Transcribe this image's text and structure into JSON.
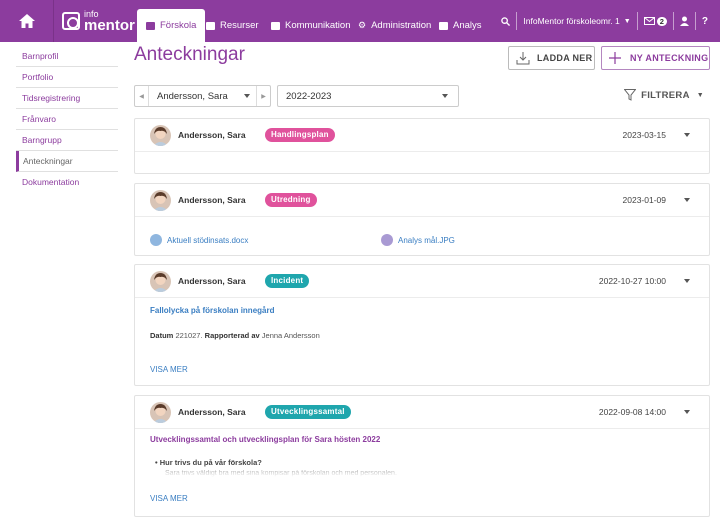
{
  "nav": {
    "logo_top": "info",
    "logo_bottom": "mentor",
    "tabs": [
      {
        "label": "Förskola"
      },
      {
        "label": "Resurser"
      },
      {
        "label": "Kommunikation"
      },
      {
        "label": "Administration"
      },
      {
        "label": "Analys"
      }
    ],
    "account_label": "InfoMentor förskoleomr. 1",
    "message_count": "2",
    "help_label": "?"
  },
  "sidebar": {
    "items": [
      {
        "label": "Barnprofil"
      },
      {
        "label": "Portfolio"
      },
      {
        "label": "Tidsregistrering"
      },
      {
        "label": "Frånvaro"
      },
      {
        "label": "Barngrupp"
      },
      {
        "label": "Anteckningar"
      },
      {
        "label": "Dokumentation"
      }
    ]
  },
  "page": {
    "title": "Anteckningar",
    "download_label": "LADDA NER",
    "new_note_label": "NY ANTECKNING",
    "person_select": "Andersson, Sara",
    "year_select": "2022-2023",
    "filter_label": "FILTRERA"
  },
  "notes": [
    {
      "name": "Andersson, Sara",
      "tag": "Handlingsplan",
      "tag_color": "#e0529c",
      "date": "2023-03-15"
    },
    {
      "name": "Andersson, Sara",
      "tag": "Utredning",
      "tag_color": "#e0529c",
      "date": "2023-01-09",
      "attachments": [
        "Aktuell stödinsats.docx",
        "Analys mål.JPG"
      ]
    },
    {
      "name": "Andersson, Sara",
      "tag": "Incident",
      "tag_color": "#1fa6ad",
      "date": "2022-10-27 10:00",
      "title": "Fallolycka på förskolan innegård",
      "meta_datum_label": "Datum",
      "meta_datum": "221027.",
      "meta_rapp_label": "Rapporterad av",
      "meta_rapp": "Jenna Andersson",
      "more": "VISA MER"
    },
    {
      "name": "Andersson, Sara",
      "tag": "Utvecklingssamtal",
      "tag_color": "#1fa6ad",
      "date": "2022-09-08 14:00",
      "title": "Utvecklingssamtal och utvecklingsplan för Sara hösten 2022",
      "bullet": "Hur trivs du på vår förskola?",
      "faded": "Sara trivs väldigt bra med sina kompisar på förskolan och med personalen.",
      "more": "VISA MER"
    }
  ],
  "colors": {
    "brand": "#8c3c9e",
    "link": "#3a7ec2",
    "pink_tag": "#e0529c",
    "teal_tag": "#1fa6ad"
  }
}
